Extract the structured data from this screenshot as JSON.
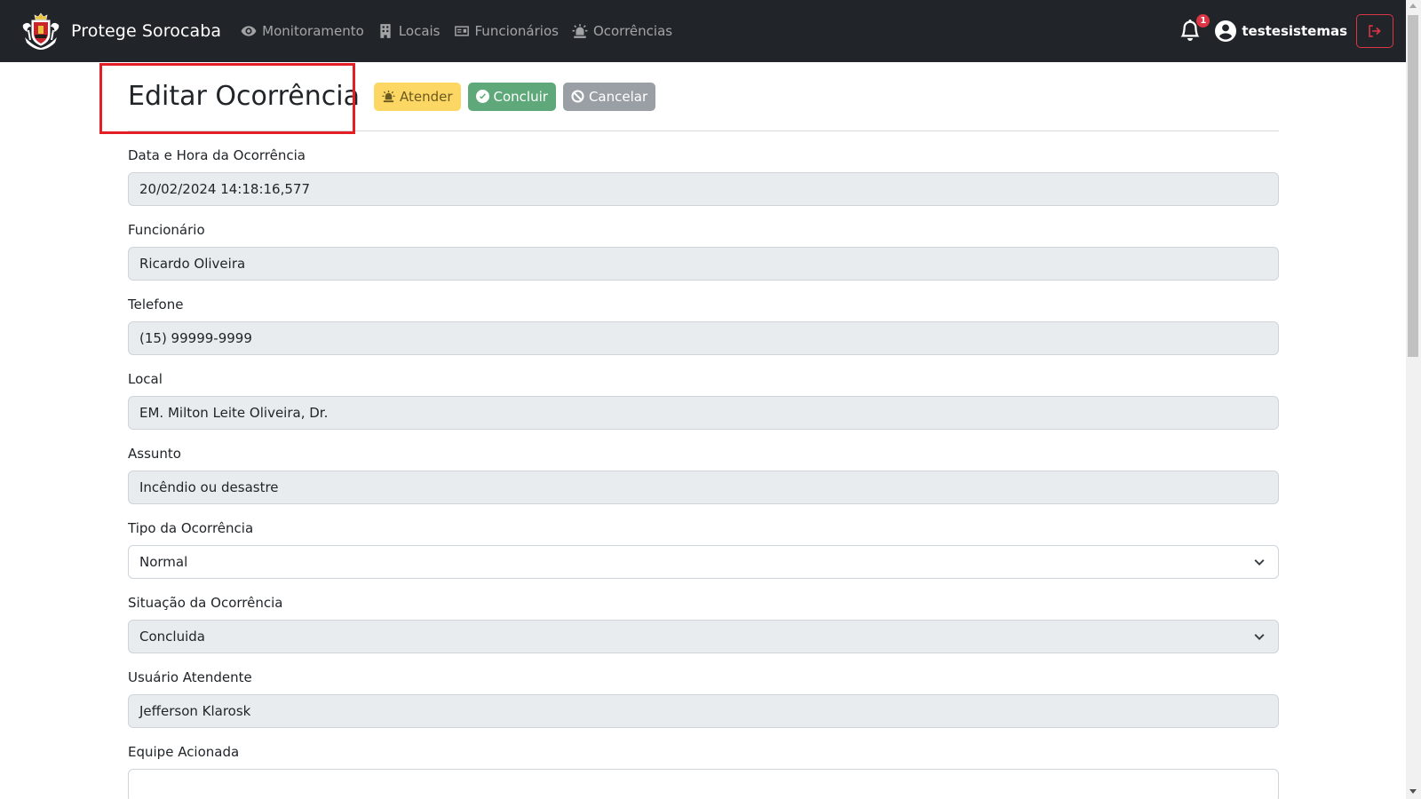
{
  "navbar": {
    "brand": "Protege Sorocaba",
    "links": [
      {
        "label": "Monitoramento",
        "icon": "eye-icon"
      },
      {
        "label": "Locais",
        "icon": "building-icon"
      },
      {
        "label": "Funcionários",
        "icon": "id-card-icon"
      },
      {
        "label": "Ocorrências",
        "icon": "siren-icon"
      }
    ],
    "notifications_count": "1",
    "username": "testesistemas"
  },
  "page": {
    "title": "Editar Ocorrência",
    "actions": {
      "atender": "Atender",
      "concluir": "Concluir",
      "cancelar": "Cancelar"
    }
  },
  "form": {
    "data_hora": {
      "label": "Data e Hora da Ocorrência",
      "value": "20/02/2024 14:18:16,577"
    },
    "funcionario": {
      "label": "Funcionário",
      "value": "Ricardo Oliveira"
    },
    "telefone": {
      "label": "Telefone",
      "value": "(15) 99999-9999"
    },
    "local": {
      "label": "Local",
      "value": "EM. Milton Leite Oliveira, Dr."
    },
    "assunto": {
      "label": "Assunto",
      "value": "Incêndio ou desastre"
    },
    "tipo": {
      "label": "Tipo da Ocorrência",
      "value": "Normal"
    },
    "situacao": {
      "label": "Situação da Ocorrência",
      "value": "Concluida"
    },
    "usuario": {
      "label": "Usuário Atendente",
      "value": "Jefferson Klarosk"
    },
    "equipe": {
      "label": "Equipe Acionada",
      "value": ""
    }
  },
  "colors": {
    "navbar": "#212529",
    "warning": "#fdd764",
    "success": "#5ea879",
    "secondary": "#9a9fa5",
    "danger": "#dc3545",
    "highlight": "#e31e24"
  }
}
